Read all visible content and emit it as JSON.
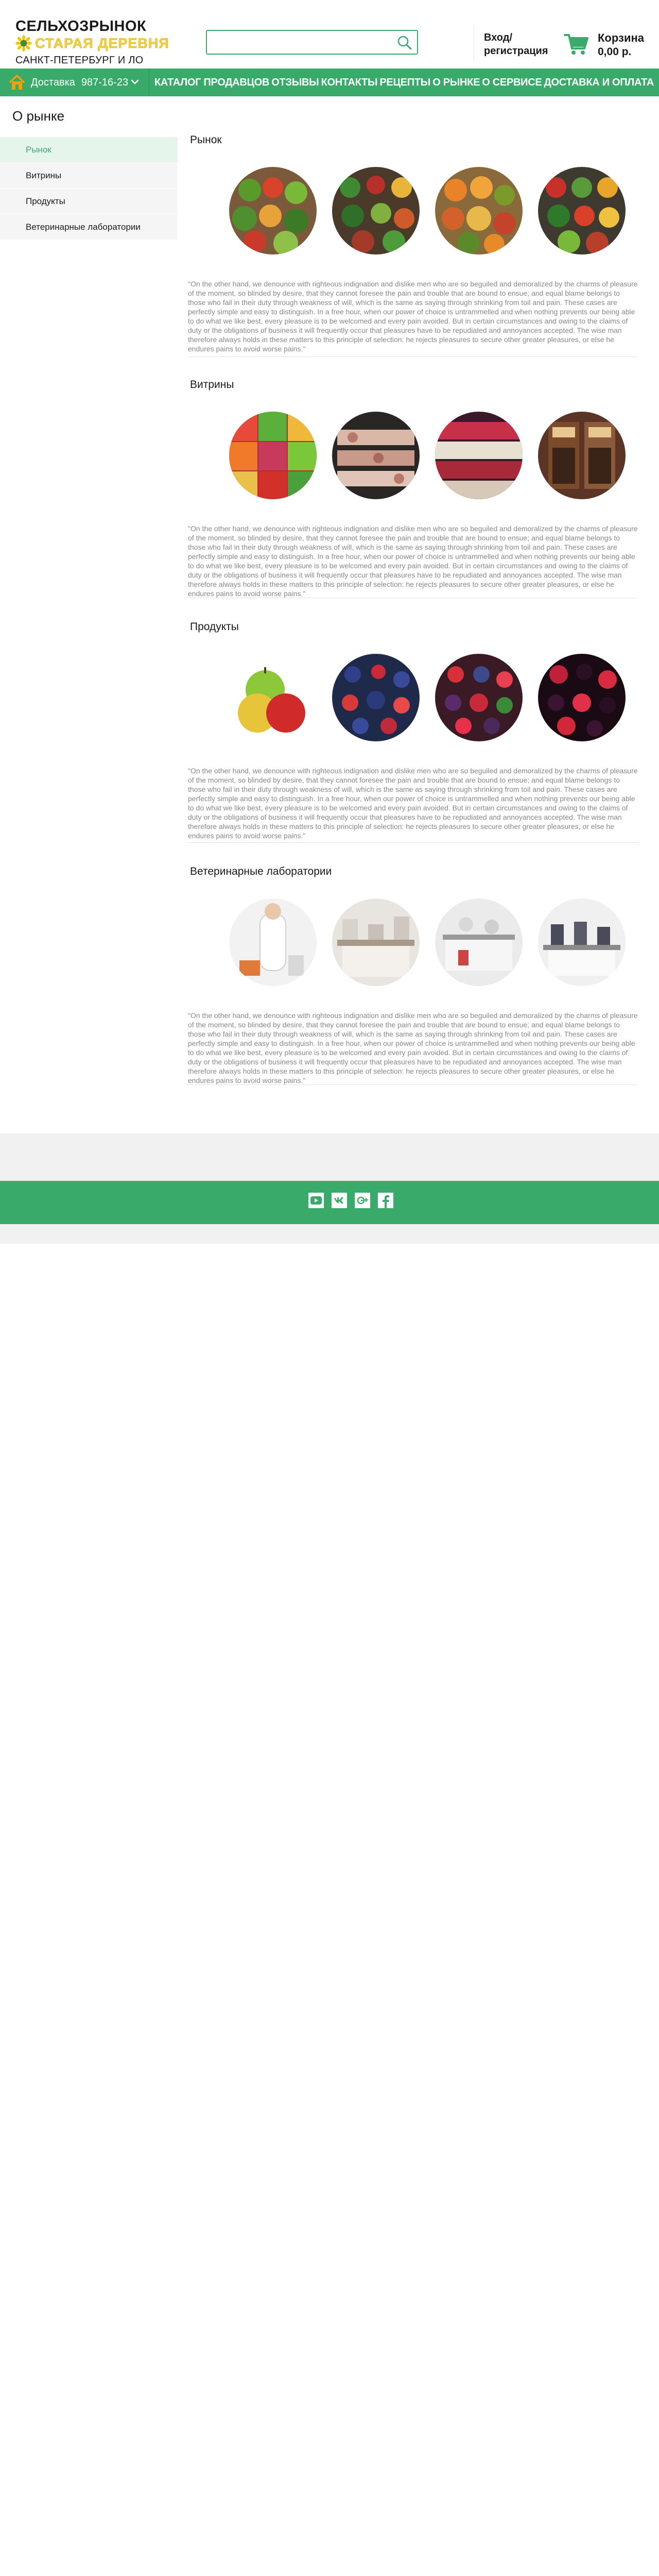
{
  "brand": {
    "line1": "СЕЛЬХОЗРЫНОК",
    "line2": "СТАРАЯ ДЕРЕВНЯ",
    "line3": "САНКТ-ПЕТЕРБУРГ И ЛО",
    "accent_color": "#f4d03f"
  },
  "search": {
    "placeholder": "",
    "icon": "search-icon"
  },
  "header": {
    "login_line1": "Вход/",
    "login_line2": "регистрация",
    "cart_label": "Корзина",
    "cart_total": "0,00 р."
  },
  "nav": {
    "color": "#3aaa6a",
    "delivery_label": "Доставка",
    "delivery_phone": "987-16-23",
    "items": [
      "КАТАЛОГ ПРОДАВЦОВ",
      "ОТЗЫВЫ",
      "КОНТАКТЫ",
      "РЕЦЕПТЫ",
      "О РЫНКЕ",
      "О СЕРВИСЕ",
      "ДОСТАВКА И ОПЛАТА"
    ]
  },
  "page": {
    "title": "О рынке"
  },
  "sidebar": {
    "items": [
      {
        "label": "Рынок",
        "active": true
      },
      {
        "label": "Витрины",
        "active": false
      },
      {
        "label": "Продукты",
        "active": false
      },
      {
        "label": "Ветеринарные лаборатории",
        "active": false
      }
    ]
  },
  "sections": [
    {
      "title": "Рынок",
      "text": "\"On the other hand, we denounce with righteous indignation and dislike men who are so beguiled and demoralized by the charms of pleasure of the moment, so blinded by desire, that they cannot foresee the pain and trouble that are bound to ensue; and equal blame belongs to those who fail in their duty through weakness of will, which is the same as saying through shrinking from toil and pain. These cases are perfectly simple and easy to distinguish. In a free hour, when our power of choice is untrammelled and when nothing prevents our being able to do what we like best, every pleasure is to be welcomed and every pain avoided. But in certain circumstances and owing to the claims of duty or the obligations of business it will frequently occur that pleasures have to be repudiated and annoyances accepted. The wise man therefore always holds in these matters to this principle of selection: he rejects pleasures to secure other greater pleasures, or else he endures pains to avoid worse pains.\""
    },
    {
      "title": "Витрины",
      "text": "\"On the other hand, we denounce with righteous indignation and dislike men who are so beguiled and demoralized by the charms of pleasure of the moment, so blinded by desire, that they cannot foresee the pain and trouble that are bound to ensue; and equal blame belongs to those who fail in their duty through weakness of will, which is the same as saying through shrinking from toil and pain. These cases are perfectly simple and easy to distinguish. In a free hour, when our power of choice is untrammelled and when nothing prevents our being able to do what we like best, every pleasure is to be welcomed and every pain avoided. But in certain circumstances and owing to the claims of duty or the obligations of business it will frequently occur that pleasures have to be repudiated and annoyances accepted. The wise man therefore always holds in these matters to this principle of selection: he rejects pleasures to secure other greater pleasures, or else he endures pains to avoid worse pains.\""
    },
    {
      "title": "Продукты",
      "text": "\"On the other hand, we denounce with righteous indignation and dislike men who are so beguiled and demoralized by the charms of pleasure of the moment, so blinded by desire, that they cannot foresee the pain and trouble that are bound to ensue; and equal blame belongs to those who fail in their duty through weakness of will, which is the same as saying through shrinking from toil and pain. These cases are perfectly simple and easy to distinguish. In a free hour, when our power of choice is untrammelled and when nothing prevents our being able to do what we like best, every pleasure is to be welcomed and every pain avoided. But in certain circumstances and owing to the claims of duty or the obligations of business it will frequently occur that pleasures have to be repudiated and annoyances accepted. The wise man therefore always holds in these matters to this principle of selection: he rejects pleasures to secure other greater pleasures, or else he endures pains to avoid worse pains.\""
    },
    {
      "title": "Ветеринарные лаборатории",
      "text": "\"On the other hand, we denounce with righteous indignation and dislike men who are so beguiled and demoralized by the charms of pleasure of the moment, so blinded by desire, that they cannot foresee the pain and trouble that are bound to ensue; and equal blame belongs to those who fail in their duty through weakness of will, which is the same as saying through shrinking from toil and pain. These cases are perfectly simple and easy to distinguish. In a free hour, when our power of choice is untrammelled and when nothing prevents our being able to do what we like best, every pleasure is to be welcomed and every pain avoided. But in certain circumstances and owing to the claims of duty or the obligations of business it will frequently occur that pleasures have to be repudiated and annoyances accepted. The wise man therefore always holds in these matters to this principle of selection: he rejects pleasures to secure other greater pleasures, or else he endures pains to avoid worse pains.\""
    }
  ],
  "footer": {
    "social_icons": [
      "youtube-icon",
      "vk-icon",
      "google-plus-icon",
      "facebook-icon"
    ]
  }
}
